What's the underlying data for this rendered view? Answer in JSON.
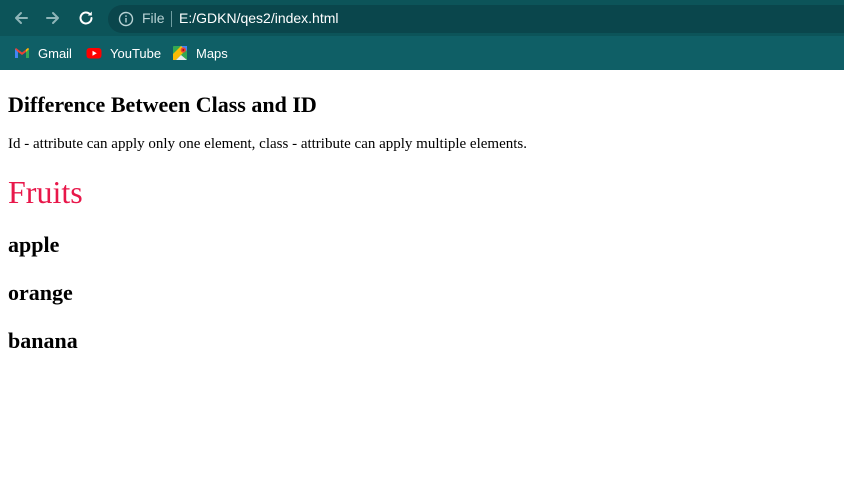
{
  "browser": {
    "omnibox": {
      "scheme_label": "File",
      "url": "E:/GDKN/qes2/index.html"
    },
    "bookmarks": [
      {
        "label": "Gmail",
        "icon": "gmail-icon"
      },
      {
        "label": "YouTube",
        "icon": "youtube-icon"
      },
      {
        "label": "Maps",
        "icon": "maps-icon"
      }
    ],
    "colors": {
      "toolbar": "#0c5459",
      "bookmarks_bar": "#0f5f66",
      "omnibox": "#0a464c"
    }
  },
  "page": {
    "heading": "Difference Between Class and ID",
    "description": "Id - attribute can apply only one element, class - attribute can apply multiple elements.",
    "fruits_title": "Fruits",
    "fruits_title_color": "#e8174a",
    "fruits": [
      "apple",
      "orange",
      "banana"
    ]
  }
}
